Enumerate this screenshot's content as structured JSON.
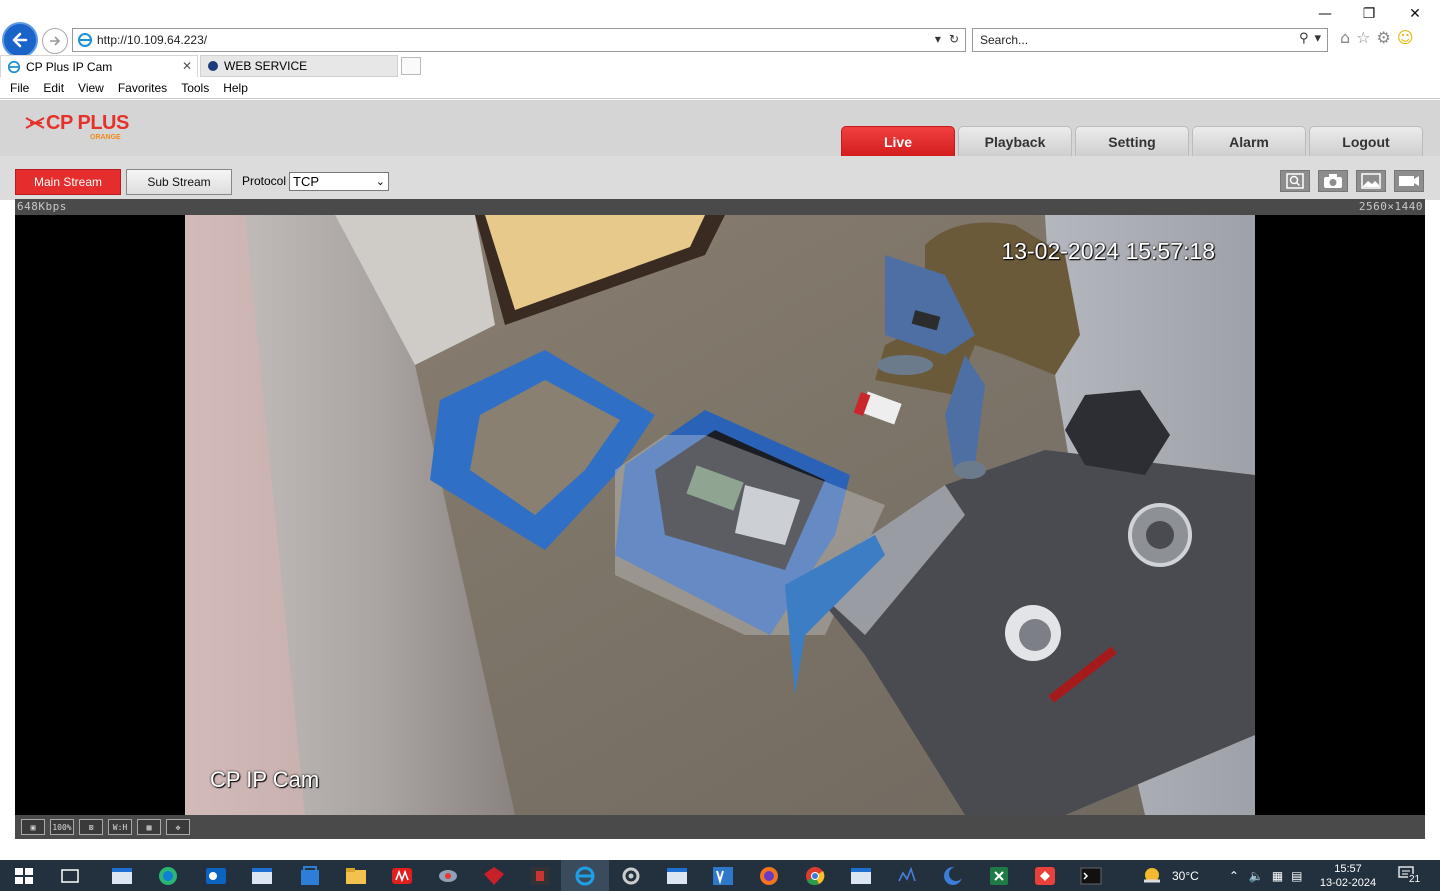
{
  "browser": {
    "url": "http://10.109.64.223/",
    "search_placeholder": "Search...",
    "tabs": [
      {
        "title": "CP Plus IP Cam"
      },
      {
        "title": "WEB SERVICE"
      }
    ],
    "menu": [
      "File",
      "Edit",
      "View",
      "Favorites",
      "Tools",
      "Help"
    ]
  },
  "app": {
    "logo_text": "CP PLUS",
    "logo_sub": "ORANGE",
    "nav": [
      "Live",
      "Playback",
      "Setting",
      "Alarm",
      "Logout"
    ],
    "active_nav": "Live",
    "accent_color": "#e4322b"
  },
  "toolbar": {
    "main_stream": "Main Stream",
    "sub_stream": "Sub Stream",
    "protocol_label": "Protocol",
    "protocol_value": "TCP"
  },
  "video": {
    "bitrate": "648Kbps",
    "resolution": "2560×1440",
    "timestamp": "13-02-2024 15:57:18",
    "camera_name": "CP IP Cam",
    "bottom_tools": [
      "fullscreen",
      "100%",
      "fit",
      "W:H",
      "zoom",
      "ptz"
    ]
  },
  "taskbar": {
    "temperature": "30°C",
    "time": "15:57",
    "date": "13-02-2024",
    "notifications": "21"
  }
}
